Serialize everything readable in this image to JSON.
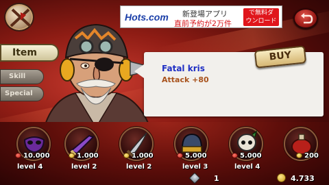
{
  "ad": {
    "brand": "Hots.com",
    "line1": "新登場アプリ",
    "line2": "直前予約が2万件",
    "cta_line1": "で無料ダ",
    "cta_line2": "ウンロード"
  },
  "tabs": {
    "item": "Item",
    "skill": "Skill",
    "special": "Special"
  },
  "selected_item": {
    "name": "Fatal kris",
    "stat": "Attack +80"
  },
  "buy_label": "BUY",
  "shop_items": [
    {
      "price": "10.000",
      "currency": "red",
      "level": "level 4",
      "icon": "purple-mask-icon"
    },
    {
      "price": "1.000",
      "currency": "gold",
      "level": "level 2",
      "icon": "purple-blade-icon"
    },
    {
      "price": "1.000",
      "currency": "gold",
      "level": "level 2",
      "icon": "kris-dagger-icon"
    },
    {
      "price": "5.000",
      "currency": "red",
      "level": "level 3",
      "icon": "helmet-icon"
    },
    {
      "price": "5.000",
      "currency": "red",
      "level": "level 4",
      "icon": "skull-icon"
    },
    {
      "price": "200",
      "currency": "gold",
      "level": "",
      "icon": "potion-icon"
    }
  ],
  "currency": {
    "gems": "1",
    "gold": "4.733"
  },
  "colors": {
    "item_name": "#1f2fc4",
    "item_stat": "#a8521c",
    "background": "#8e1c14"
  }
}
